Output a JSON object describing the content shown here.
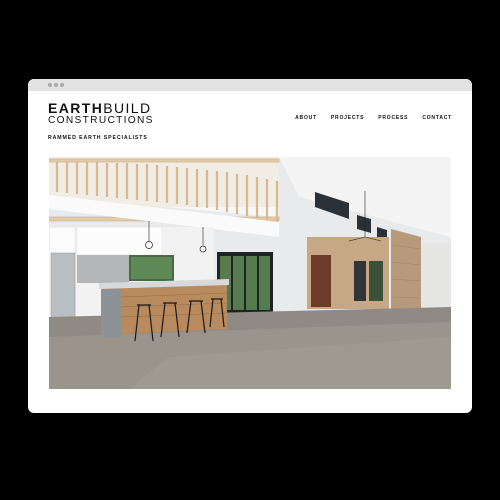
{
  "browser": {
    "window_dots": 3
  },
  "brand": {
    "name_bold": "EARTH",
    "name_light": "BUILD",
    "name_line2": "CONSTRUCTIONS",
    "tagline": "RAMMED EARTH SPECIALISTS"
  },
  "nav": {
    "items": [
      {
        "label": "ABOUT"
      },
      {
        "label": "PROJECTS"
      },
      {
        "label": "PROCESS"
      },
      {
        "label": "CONTACT"
      }
    ]
  },
  "hero": {
    "subject": "open-plan kitchen interior with mezzanine and rammed earth wall"
  },
  "colors": {
    "page_bg": "#000000",
    "window_bg": "#ffffff",
    "titlebar": "#e3e3e3",
    "text": "#111111"
  }
}
